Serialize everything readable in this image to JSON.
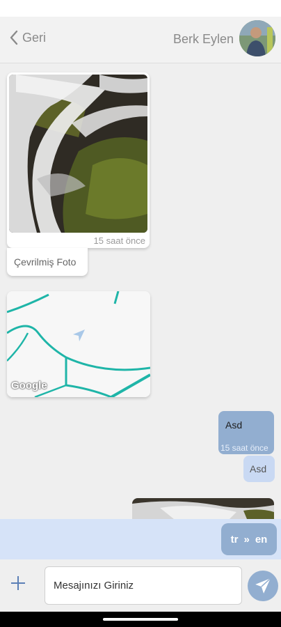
{
  "header": {
    "back_label": "Geri",
    "contact_name": "Berk Eylen"
  },
  "messages": {
    "photo_time": "15 saat önce",
    "photo_caption": "Çevrilmiş Foto",
    "map_attribution": "Google",
    "outgoing_text": "Asd",
    "outgoing_time": "15 saat önce",
    "outgoing_translation": "Asd"
  },
  "translate": {
    "from": "tr",
    "arrow": "»",
    "to": "en"
  },
  "composer": {
    "placeholder": "Mesajınızı Giriniz",
    "value": ""
  },
  "colors": {
    "accent": "#92aed0",
    "translate_bar": "#d6e3f8",
    "map_road": "#1fb5a8"
  }
}
